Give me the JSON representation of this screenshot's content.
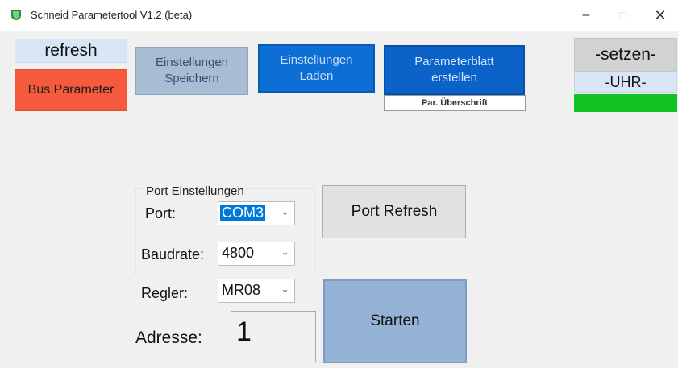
{
  "window": {
    "title": "Schneid Parametertool V1.2 (beta)",
    "minimize": "–",
    "maximize": "□",
    "close": "✕",
    "icon": "app-shield-icon",
    "icon_color": "#2e8b3b"
  },
  "toolbar": {
    "refresh": "refresh",
    "bus_parameter": "Bus Parameter",
    "save_settings": "Einstellungen\nSpeichern",
    "load_settings": "Einstellungen\nLaden",
    "create_sheet": "Parameterblatt\nerstellen",
    "sheet_caption": "Par. Überschrift"
  },
  "clock": {
    "set": "-setzen-",
    "label": "-UHR-",
    "progress": 1.0,
    "progress_color": "#11c223"
  },
  "port_settings": {
    "group_label": "Port Einstellungen",
    "port_label": "Port:",
    "port_value": "COM3",
    "baud_label": "Baudrate:",
    "baud_value": "4800",
    "refresh_button": "Port Refresh"
  },
  "controller": {
    "label": "Regler:",
    "value": "MR08"
  },
  "address": {
    "label": "Adresse:",
    "value": "1"
  },
  "start_button": "Starten",
  "colors": {
    "bus_parameter": "#f55a3c",
    "load_button": "#0d6fd6",
    "sheet_button": "#0b62c9",
    "start_button": "#94b2d6"
  }
}
